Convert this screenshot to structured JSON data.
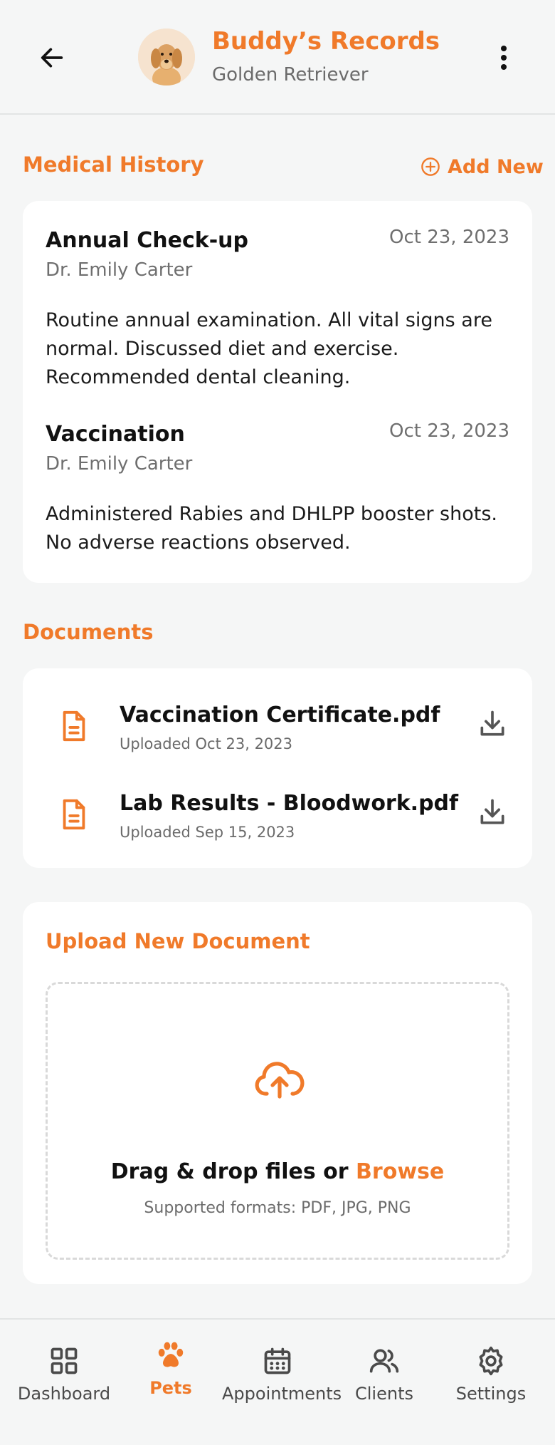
{
  "header": {
    "pet_name": "Buddy’s Records",
    "breed": "Golden Retriever"
  },
  "medical": {
    "title": "Medical History",
    "add_label": "Add New",
    "records": [
      {
        "title": "Annual Check-up",
        "date": "Oct 23, 2023",
        "doctor": "Dr. Emily Carter",
        "notes": "Routine annual examination. All vital signs are normal. Discussed diet and exercise. Recommended dental cleaning."
      },
      {
        "title": "Vaccination",
        "date": "Oct 23, 2023",
        "doctor": "Dr. Emily Carter",
        "notes": "Administered Rabies and DHLPP booster shots. No adverse reactions observed."
      }
    ]
  },
  "documents": {
    "title": "Documents",
    "items": [
      {
        "name": "Vaccination Certificate.pdf",
        "meta": "Uploaded Oct 23, 2023"
      },
      {
        "name": "Lab Results - Bloodwork.pdf",
        "meta": "Uploaded Sep 15, 2023"
      }
    ]
  },
  "upload": {
    "title": "Upload New Document",
    "drop_text": "Drag & drop files or ",
    "browse_label": "Browse",
    "formats": "Supported formats: PDF, JPG, PNG"
  },
  "nav": {
    "items": [
      {
        "label": "Dashboard",
        "icon": "grid-icon"
      },
      {
        "label": "Pets",
        "icon": "paw-icon",
        "active": true
      },
      {
        "label": "Appointments",
        "icon": "calendar-icon"
      },
      {
        "label": "Clients",
        "icon": "users-icon"
      },
      {
        "label": "Settings",
        "icon": "gear-icon"
      }
    ]
  },
  "colors": {
    "accent": "#f07a2a",
    "background": "#f5f6f6",
    "card": "#ffffff"
  }
}
